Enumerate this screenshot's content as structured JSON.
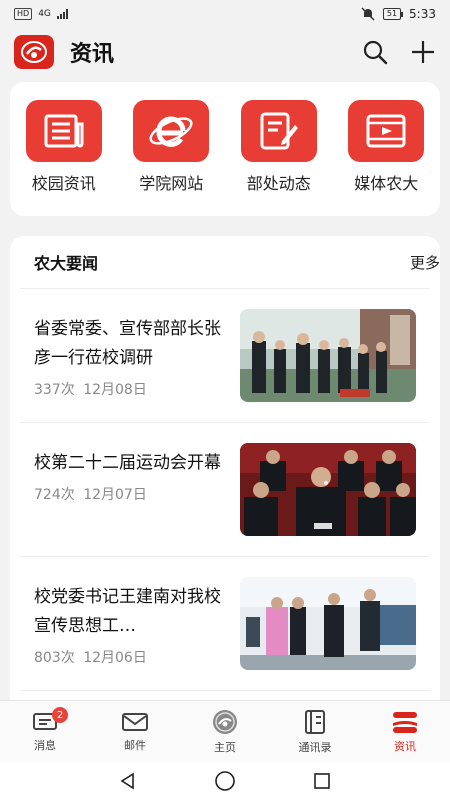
{
  "status_bar": {
    "network": "HD",
    "signal_label": "4G",
    "battery": "51",
    "time": "5:33"
  },
  "header": {
    "title": "资讯",
    "logo_icon": "university-logo-icon",
    "search_icon": "search-icon",
    "add_icon": "plus-icon"
  },
  "quick_links": [
    {
      "label": "校园资讯",
      "icon": "newspaper-icon"
    },
    {
      "label": "学院网站",
      "icon": "browser-e-icon"
    },
    {
      "label": "部处动态",
      "icon": "edit-document-icon"
    },
    {
      "label": "媒体农大",
      "icon": "video-film-icon"
    }
  ],
  "news": {
    "section_title": "农大要闻",
    "more_label": "更多",
    "articles": [
      {
        "headline": "省委常委、宣传部部长张彦一行莅校调研",
        "views": "337次",
        "date": "12月08日"
      },
      {
        "headline": "校第二十二届运动会开幕",
        "views": "724次",
        "date": "12月07日"
      },
      {
        "headline": "校党委书记王建南对我校宣传思想工…",
        "views": "803次",
        "date": "12月06日"
      }
    ]
  },
  "tabbar": [
    {
      "label": "消息",
      "icon": "message-icon",
      "badge": "2"
    },
    {
      "label": "邮件",
      "icon": "mail-icon"
    },
    {
      "label": "主页",
      "icon": "home-emblem-icon"
    },
    {
      "label": "通讯录",
      "icon": "contacts-book-icon"
    },
    {
      "label": "资讯",
      "icon": "news-icon",
      "active": true
    }
  ],
  "colors": {
    "accent": "#d9261c",
    "icon_bg": "#e83d35"
  }
}
